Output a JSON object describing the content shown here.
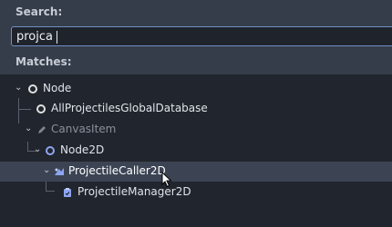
{
  "search": {
    "label": "Search:",
    "value": "projca"
  },
  "matches": {
    "label": "Matches:"
  },
  "tree": [
    {
      "label": "Node",
      "icon": "circle-icon"
    },
    {
      "label": "AllProjectilesGlobalDatabase",
      "icon": "circle-icon"
    },
    {
      "label": "CanvasItem",
      "icon": "pencil-icon"
    },
    {
      "label": "Node2D",
      "icon": "circle-icon"
    },
    {
      "label": "ProjectileCaller2D",
      "icon": "node2d-script-icon"
    },
    {
      "label": "ProjectileManager2D",
      "icon": "clipboard-icon"
    }
  ],
  "colors": {
    "accent": "#6f90c6",
    "selection": "#3c4454",
    "node2d": "#8da5f3"
  }
}
